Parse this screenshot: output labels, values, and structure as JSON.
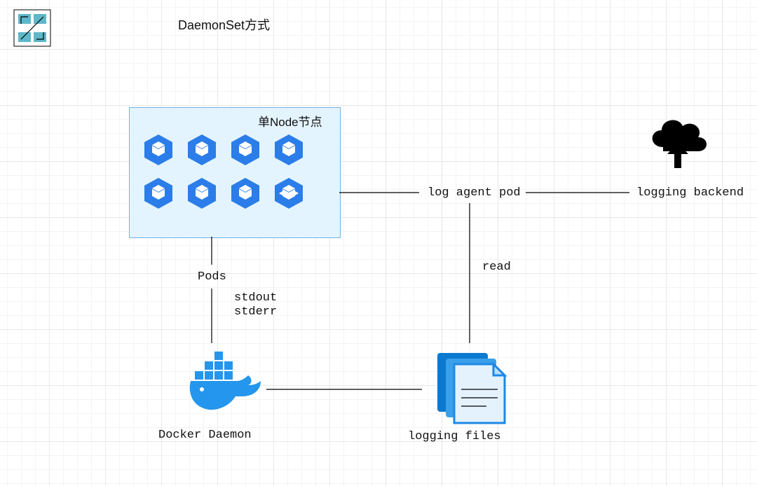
{
  "title": "DaemonSet方式",
  "node": {
    "label": "单Node节点"
  },
  "labels": {
    "pods": "Pods",
    "stdout_stderr_1": "stdout",
    "stdout_stderr_2": "stderr",
    "docker_daemon": "Docker Daemon",
    "log_agent_pod": "log agent pod",
    "read": "read",
    "logging_files": "logging files",
    "logging_backend": "logging backend"
  }
}
